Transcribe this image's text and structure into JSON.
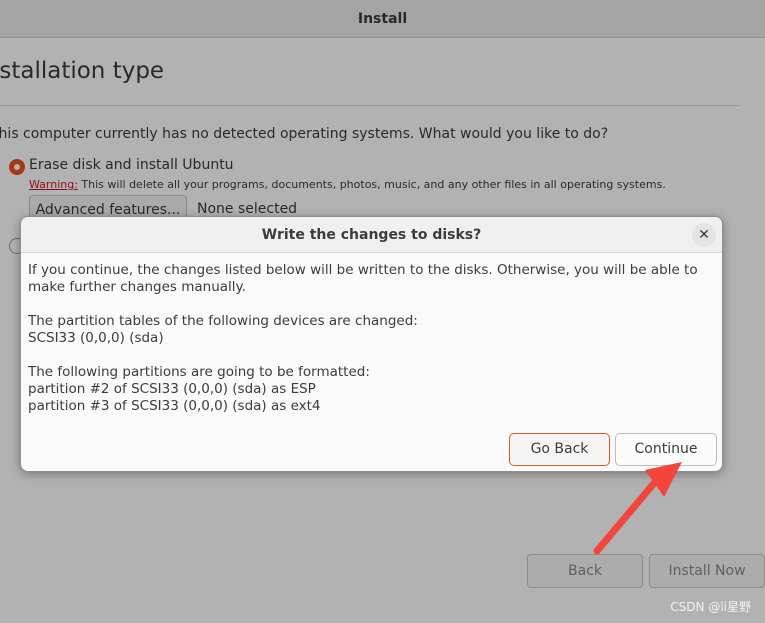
{
  "window": {
    "title": "Install",
    "heading": "Installation type",
    "question": "This computer currently has no detected operating systems. What would you like to do?",
    "option_erase": "Erase disk and install Ubuntu",
    "warning_label": "Warning:",
    "warning_text": " This will delete all your programs, documents, photos, music, and any other files in all operating systems.",
    "advanced_button": "Advanced features...",
    "advanced_value": "None selected",
    "back_button": "Back",
    "install_button": "Install Now"
  },
  "dialog": {
    "title": "Write the changes to disks?",
    "close_icon": "close-icon",
    "intro": "If you continue, the changes listed below will be written to the disks. Otherwise, you will be able to make further changes manually.",
    "tables_heading": "The partition tables of the following devices are changed:",
    "tables_device": " SCSI33 (0,0,0) (sda)",
    "format_heading": "The following partitions are going to be formatted:",
    "format_items": [
      " partition #2 of SCSI33 (0,0,0) (sda) as ESP",
      " partition #3 of SCSI33 (0,0,0) (sda) as ext4"
    ],
    "go_back_button": "Go Back",
    "continue_button": "Continue"
  },
  "watermark": "CSDN @li星野",
  "colors": {
    "accent": "#e95420",
    "arrow": "#f2453d"
  }
}
